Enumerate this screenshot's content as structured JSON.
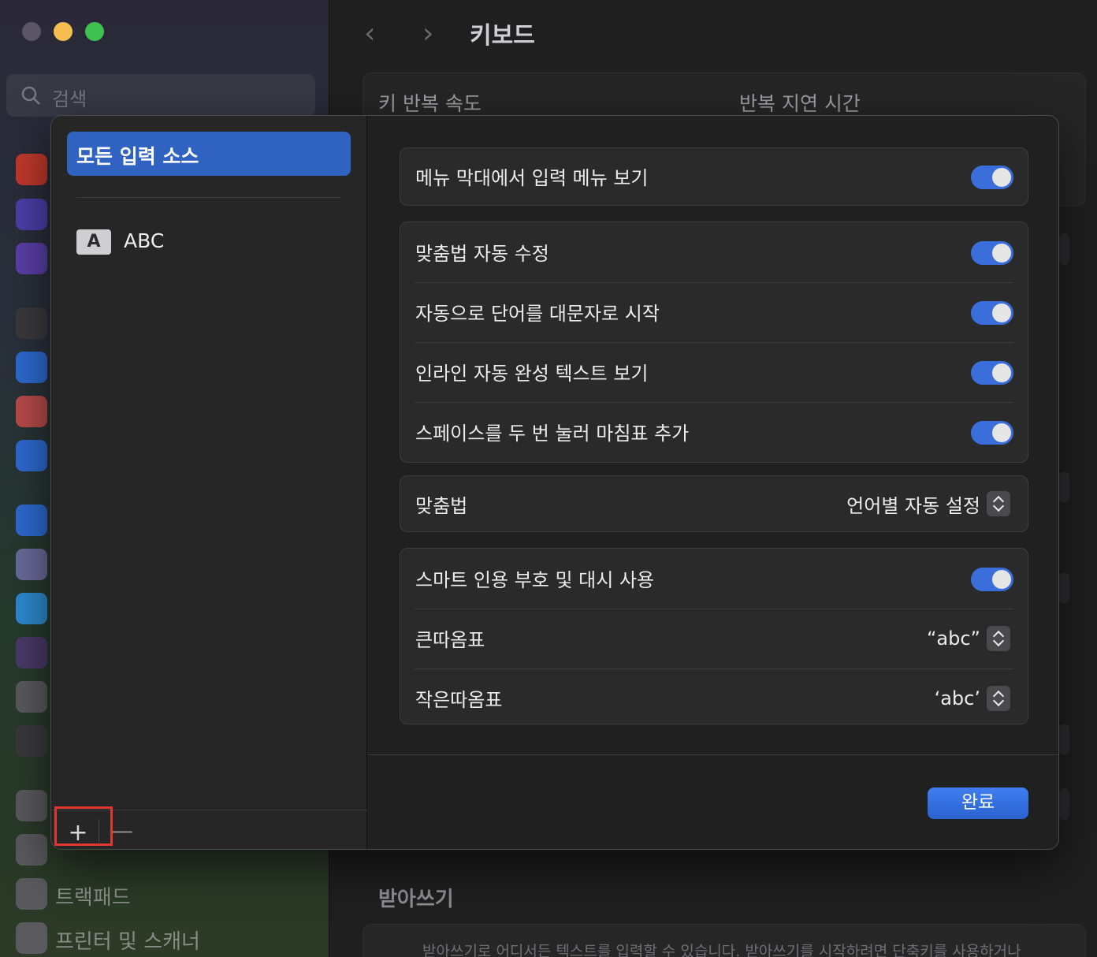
{
  "background": {
    "search": {
      "placeholder": "검색"
    },
    "window_title": "키보드",
    "key_repeat_label": "키 반복 속도",
    "repeat_delay_label": "반복 지연 시간",
    "sidebar_items": [
      {
        "label": "트랙패드",
        "icon": "trackpad-icon"
      },
      {
        "label": "프린터 및 스캐너",
        "icon": "printer-icon"
      }
    ],
    "dictation_section": "받아쓰기",
    "dictation_text": "받아쓰기로 어디서든 텍스트를 입력할 수 있습니다. 받아쓰기를 시작하려면 단축키를 사용하거나"
  },
  "sheet": {
    "sources": {
      "selected": "모든 입력 소스",
      "items": [
        {
          "badge": "A",
          "label": "ABC"
        }
      ],
      "add": "+",
      "remove": "—"
    },
    "groups": [
      {
        "rows": [
          {
            "label": "메뉴 막대에서 입력 메뉴 보기",
            "control": "toggle",
            "on": true
          }
        ]
      },
      {
        "rows": [
          {
            "label": "맞춤법 자동 수정",
            "control": "toggle",
            "on": true
          },
          {
            "label": "자동으로 단어를 대문자로 시작",
            "control": "toggle",
            "on": true
          },
          {
            "label": "인라인 자동 완성 텍스트 보기",
            "control": "toggle",
            "on": true
          },
          {
            "label": "스페이스를 두 번 눌러 마침표 추가",
            "control": "toggle",
            "on": true
          }
        ]
      },
      {
        "rows": [
          {
            "label": "맞춤법",
            "control": "popup",
            "value": "언어별 자동 설정"
          }
        ]
      },
      {
        "rows": [
          {
            "label": "스마트 인용 부호 및 대시 사용",
            "control": "toggle",
            "on": true
          },
          {
            "label": "큰따옴표",
            "control": "popup",
            "value": "“abc”"
          },
          {
            "label": "작은따옴표",
            "control": "popup",
            "value": "‘abc’"
          }
        ]
      }
    ],
    "done_label": "완료"
  },
  "colors": {
    "accent": "#2f62c1",
    "toggle_on": "#3a6fdb",
    "highlight": "#e0382c"
  }
}
